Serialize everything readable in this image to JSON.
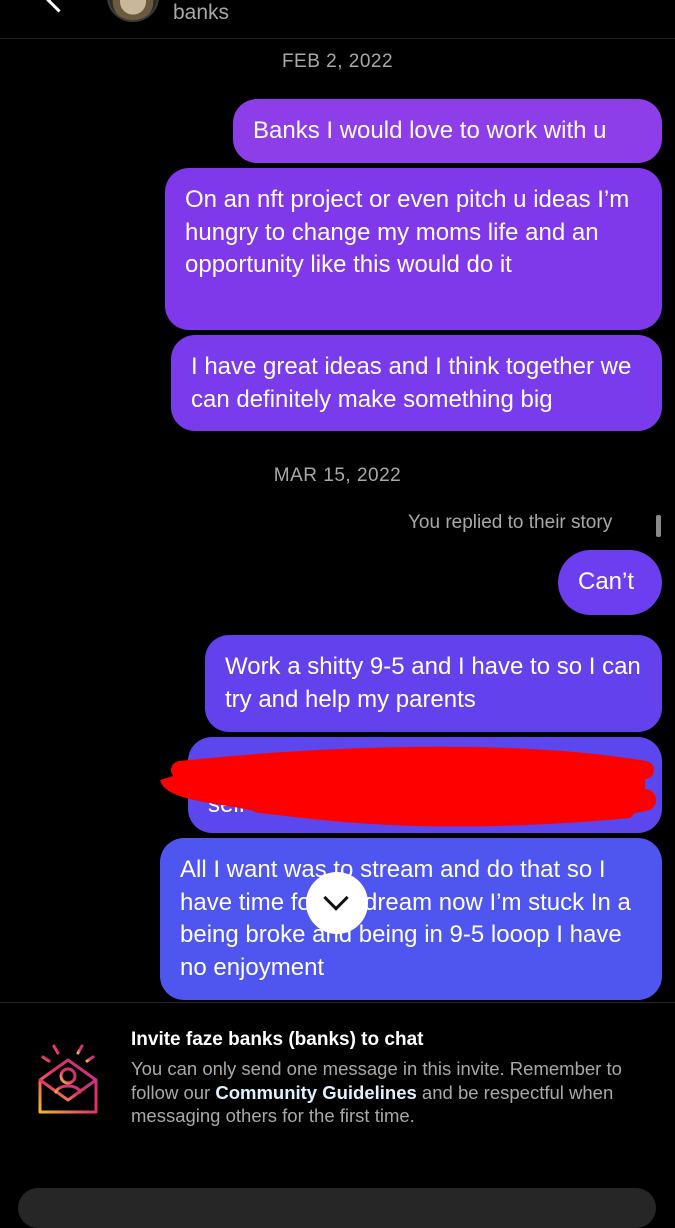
{
  "header": {
    "username": "banks",
    "back_icon": "chevron-left-icon"
  },
  "conversation": {
    "date_1": "FEB 2, 2022",
    "messages_1": [
      "Banks I would love to work with u",
      "On an nft project or even pitch u ideas I’m hungry to change my moms life and an opportunity like this would do it",
      "I have great ideas and I think together we can definitely make something big"
    ],
    "date_2": "MAR 15, 2022",
    "story_reply_note": "You replied to their story",
    "messages_2": [
      "Can’t",
      "Work a shitty 9-5 and I have to so I can try and help my parents",
      "self",
      "All I want was to stream and do that so I have time for my dream now I’m stuck In a being broke and being in 9-5 looop I have no enjoyment"
    ]
  },
  "scroll_button": {
    "icon": "chevron-down-icon"
  },
  "invite": {
    "title": "Invite faze banks (banks) to chat",
    "body_before": "You can only send one message in this invite. Remember to follow our ",
    "link_text": "Community Guidelines",
    "body_after": " and be respectful when messaging others for the first time.",
    "icon": "invite-envelope-icon"
  },
  "colors": {
    "background": "#000000",
    "redaction": "#ff0000",
    "muted_text": "#a8a8a8"
  }
}
